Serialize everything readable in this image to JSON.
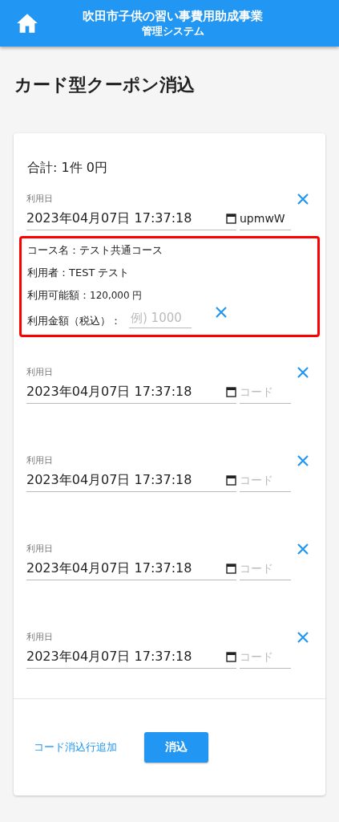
{
  "header": {
    "title": "吹田市子供の習い事費用助成事業",
    "subtitle": "管理システム"
  },
  "page_title": "カード型クーポン消込",
  "total": "合計: 1件 0円",
  "entries": [
    {
      "label": "利用日",
      "date": "2023年04月07日 17:37:18",
      "code": {
        "value": "upmwW"
      },
      "detail": {
        "course": "コース名：テスト共通コース",
        "user": "利用者：TEST テスト",
        "available_label": "利用可能額：",
        "available_value": "120,000 円",
        "amount_label": "利用金額（税込）：",
        "amount_placeholder": "例) 1000"
      }
    },
    {
      "label": "利用日",
      "date": "2023年04月07日 17:37:18",
      "code": {
        "placeholder": "コード"
      }
    },
    {
      "label": "利用日",
      "date": "2023年04月07日 17:37:18",
      "code": {
        "placeholder": "コード"
      }
    },
    {
      "label": "利用日",
      "date": "2023年04月07日 17:37:18",
      "code": {
        "placeholder": "コード"
      }
    },
    {
      "label": "利用日",
      "date": "2023年04月07日 17:37:18",
      "code": {
        "placeholder": "コード"
      }
    }
  ],
  "footer": {
    "add_link": "コード消込行追加",
    "submit": "消込"
  }
}
